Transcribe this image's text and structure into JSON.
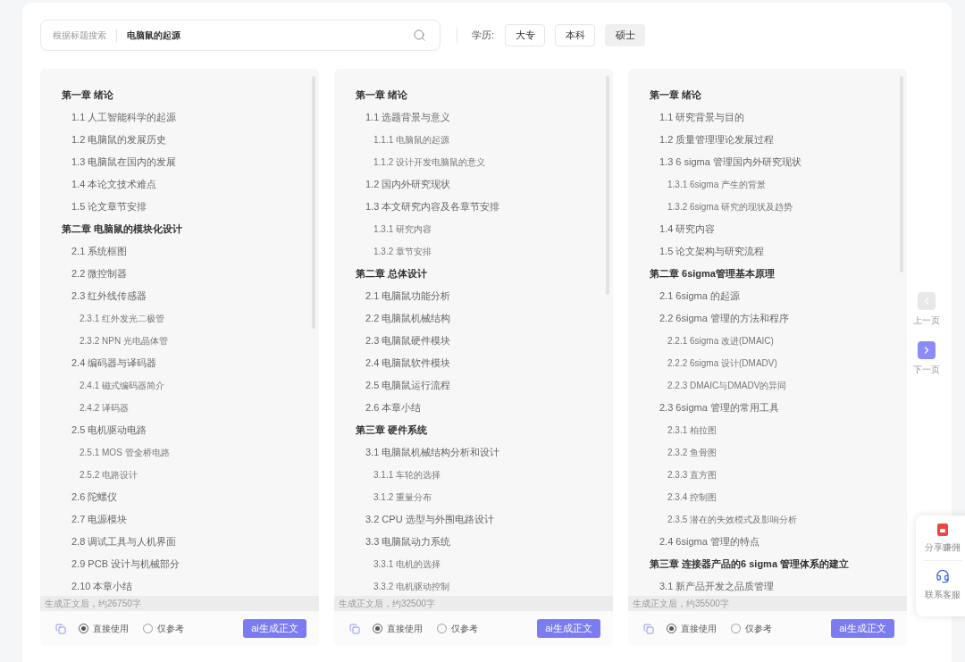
{
  "search": {
    "mode_label": "根据标题搜索",
    "value": "电脑鼠的起源"
  },
  "filter": {
    "label": "学历:",
    "options": [
      {
        "label": "大专",
        "selected": false
      },
      {
        "label": "本科",
        "selected": false
      },
      {
        "label": "硕士",
        "selected": true
      }
    ]
  },
  "outlines": [
    {
      "items": [
        {
          "title": "第一章 绪论",
          "children": [
            {
              "title": "1.1 人工智能科学的起源"
            },
            {
              "title": "1.2 电脑鼠的发展历史"
            },
            {
              "title": "1.3 电脑鼠在国内的发展"
            },
            {
              "title": "1.4 本论文技术难点"
            },
            {
              "title": "1.5 论文章节安排"
            }
          ]
        },
        {
          "title": "第二章 电脑鼠的模块化设计",
          "children": [
            {
              "title": "2.1 系统框图"
            },
            {
              "title": "2.2 微控制器"
            },
            {
              "title": "2.3 红外线传感器",
              "children": [
                {
                  "title": "2.3.1 红外发光二极管"
                },
                {
                  "title": "2.3.2 NPN 光电晶体管"
                }
              ]
            },
            {
              "title": "2.4 编码器与译码器",
              "children": [
                {
                  "title": "2.4.1 磁式编码器简介"
                },
                {
                  "title": "2.4.2 译码器"
                }
              ]
            },
            {
              "title": "2.5 电机驱动电路",
              "children": [
                {
                  "title": "2.5.1 MOS 管全桥电路"
                },
                {
                  "title": "2.5.2 电路设计"
                }
              ]
            },
            {
              "title": "2.6 陀螺仪"
            },
            {
              "title": "2.7 电源模块"
            },
            {
              "title": "2.8 调试工具与人机界面"
            },
            {
              "title": "2.9 PCB 设计与机械部分"
            },
            {
              "title": "2.10 本章小结"
            }
          ]
        }
      ],
      "word_count": "生成正文后，约26750字",
      "modes": [
        {
          "label": "直接使用",
          "selected": true
        },
        {
          "label": "仅参考",
          "selected": false
        }
      ],
      "action": "ai生成正文"
    },
    {
      "items": [
        {
          "title": "第一章 绪论",
          "children": [
            {
              "title": "1.1 选题背景与意义",
              "children": [
                {
                  "title": "1.1.1 电脑鼠的起源"
                },
                {
                  "title": "1.1.2 设计开发电脑鼠的意义"
                }
              ]
            },
            {
              "title": "1.2 国内外研究现状"
            },
            {
              "title": "1.3 本文研究内容及各章节安排",
              "children": [
                {
                  "title": "1.3.1 研究内容"
                },
                {
                  "title": "1.3.2 章节安排"
                }
              ]
            }
          ]
        },
        {
          "title": "第二章 总体设计",
          "children": [
            {
              "title": "2.1 电脑鼠功能分析"
            },
            {
              "title": "2.2 电脑鼠机械结构"
            },
            {
              "title": "2.3 电脑鼠硬件模块"
            },
            {
              "title": "2.4 电脑鼠软件模块"
            },
            {
              "title": "2.5 电脑鼠运行流程"
            },
            {
              "title": "2.6 本章小结"
            }
          ]
        },
        {
          "title": "第三章 硬件系统",
          "children": [
            {
              "title": "3.1 电脑鼠机械结构分析和设计",
              "children": [
                {
                  "title": "3.1.1 车轮的选择"
                },
                {
                  "title": "3.1.2 重量分布"
                }
              ]
            },
            {
              "title": "3.2 CPU 选型与外围电路设计"
            },
            {
              "title": "3.3 电脑鼠动力系统",
              "children": [
                {
                  "title": "3.3.1 电机的选择"
                },
                {
                  "title": "3.3.2 电机驱动控制"
                }
              ]
            }
          ]
        }
      ],
      "word_count": "生成正文后，约32500字",
      "modes": [
        {
          "label": "直接使用",
          "selected": true
        },
        {
          "label": "仅参考",
          "selected": false
        }
      ],
      "action": "ai生成正文"
    },
    {
      "items": [
        {
          "title": "第一章 绪论",
          "children": [
            {
              "title": "1.1 研究背景与目的"
            },
            {
              "title": "1.2 质量管理理论发展过程"
            },
            {
              "title": "1.3 6 sigma 管理国内外研究现状",
              "children": [
                {
                  "title": "1.3.1 6sigma 产生的背景"
                },
                {
                  "title": "1.3.2 6sigma 研究的现状及趋势"
                }
              ]
            },
            {
              "title": "1.4 研究内容"
            },
            {
              "title": "1.5 论文架构与研究流程"
            }
          ]
        },
        {
          "title": "第二章 6sigma管理基本原理",
          "children": [
            {
              "title": "2.1 6sigma 的起源"
            },
            {
              "title": "2.2 6sigma 管理的方法和程序",
              "children": [
                {
                  "title": "2.2.1 6sigma 改进(DMAIC)"
                },
                {
                  "title": "2.2.2 6sigma 设计(DMADV)"
                },
                {
                  "title": "2.2.3 DMAIC与DMADV的异同"
                }
              ]
            },
            {
              "title": "2.3 6sigma 管理的常用工具",
              "children": [
                {
                  "title": "2.3.1 柏拉图"
                },
                {
                  "title": "2.3.2 鱼骨图"
                },
                {
                  "title": "2.3.3 直方图"
                },
                {
                  "title": "2.3.4 控制图"
                },
                {
                  "title": "2.3.5 潜在的失效模式及影响分析"
                }
              ]
            },
            {
              "title": "2.4 6sigma 管理的特点"
            }
          ]
        },
        {
          "title": "第三章 连接器产品的6 sigma 管理体系的建立",
          "children": [
            {
              "title": "3.1 新产品开发之品质管理"
            }
          ]
        }
      ],
      "word_count": "生成正文后，约35500字",
      "modes": [
        {
          "label": "直接使用",
          "selected": true
        },
        {
          "label": "仅参考",
          "selected": false
        }
      ],
      "action": "ai生成正文"
    }
  ],
  "pager": {
    "prev": {
      "label": "上一页",
      "disabled": true
    },
    "next": {
      "label": "下一页",
      "disabled": false
    }
  },
  "float_menu": [
    {
      "kind": "share",
      "label": "分享赚佣"
    },
    {
      "kind": "support",
      "label": "联系客服"
    }
  ]
}
